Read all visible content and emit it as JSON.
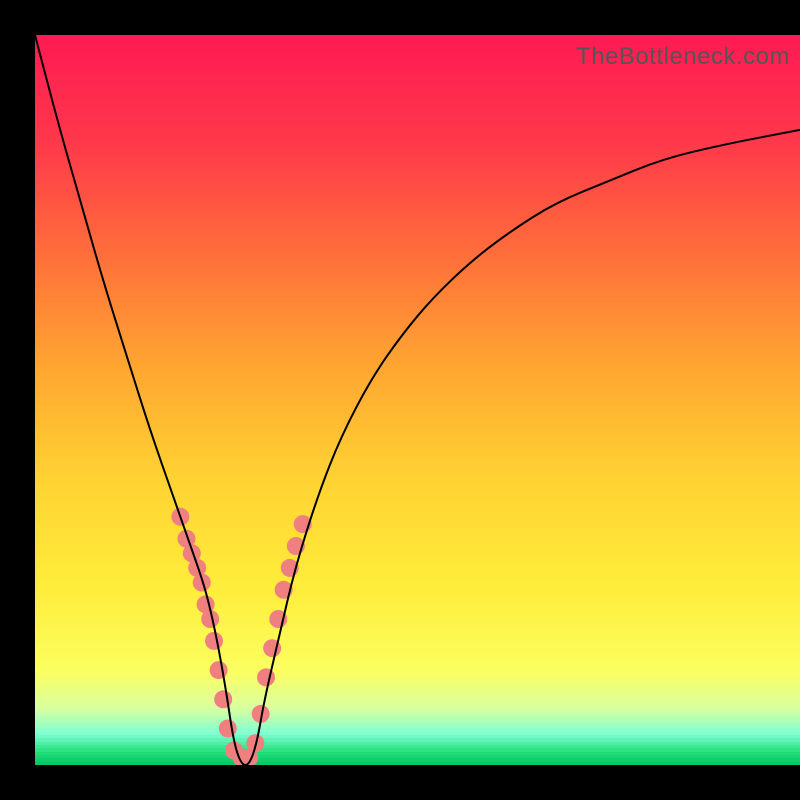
{
  "watermark": "TheBottleneck.com",
  "chart_data": {
    "type": "line",
    "title": "",
    "xlabel": "",
    "ylabel": "",
    "xlim": [
      0,
      100
    ],
    "ylim": [
      0,
      100
    ],
    "grid": false,
    "legend": false,
    "background_gradient_stops": [
      {
        "pos": 0.0,
        "color": "#ff1a53"
      },
      {
        "pos": 0.15,
        "color": "#ff3a4a"
      },
      {
        "pos": 0.3,
        "color": "#ff6f3a"
      },
      {
        "pos": 0.45,
        "color": "#ffa531"
      },
      {
        "pos": 0.6,
        "color": "#ffd132"
      },
      {
        "pos": 0.75,
        "color": "#ffec3a"
      },
      {
        "pos": 0.87,
        "color": "#fbff60"
      },
      {
        "pos": 0.92,
        "color": "#d9ffa0"
      },
      {
        "pos": 0.955,
        "color": "#7fffd4"
      },
      {
        "pos": 0.98,
        "color": "#21e07a"
      },
      {
        "pos": 1.0,
        "color": "#00c062"
      }
    ],
    "series": [
      {
        "name": "bottleneck-curve",
        "color": "#000000",
        "x": [
          0,
          3,
          6,
          9,
          12,
          15,
          18,
          20,
          22,
          23,
          24,
          25,
          26,
          27,
          28,
          29,
          30,
          32,
          34,
          37,
          40,
          44,
          48,
          52,
          57,
          62,
          68,
          75,
          82,
          90,
          100
        ],
        "y": [
          100,
          88,
          77,
          66,
          56,
          46,
          37,
          31,
          25,
          21,
          16,
          10,
          3,
          0,
          0,
          3,
          9,
          18,
          27,
          37,
          45,
          53,
          59,
          64,
          69,
          73,
          77,
          80,
          83,
          85,
          87
        ]
      }
    ],
    "markers": {
      "name": "highlight-dots",
      "color": "#f08080",
      "radius": 9,
      "points": [
        {
          "x": 19.0,
          "y": 34
        },
        {
          "x": 19.8,
          "y": 31
        },
        {
          "x": 20.5,
          "y": 29
        },
        {
          "x": 21.2,
          "y": 27
        },
        {
          "x": 21.8,
          "y": 25
        },
        {
          "x": 22.3,
          "y": 22
        },
        {
          "x": 22.9,
          "y": 20
        },
        {
          "x": 23.4,
          "y": 17
        },
        {
          "x": 24.0,
          "y": 13
        },
        {
          "x": 24.6,
          "y": 9
        },
        {
          "x": 25.2,
          "y": 5
        },
        {
          "x": 26.0,
          "y": 2
        },
        {
          "x": 27.0,
          "y": 1
        },
        {
          "x": 28.0,
          "y": 1
        },
        {
          "x": 28.8,
          "y": 3
        },
        {
          "x": 29.5,
          "y": 7
        },
        {
          "x": 30.2,
          "y": 12
        },
        {
          "x": 31.0,
          "y": 16
        },
        {
          "x": 31.8,
          "y": 20
        },
        {
          "x": 32.5,
          "y": 24
        },
        {
          "x": 33.3,
          "y": 27
        },
        {
          "x": 34.1,
          "y": 30
        },
        {
          "x": 35.0,
          "y": 33
        }
      ]
    }
  }
}
